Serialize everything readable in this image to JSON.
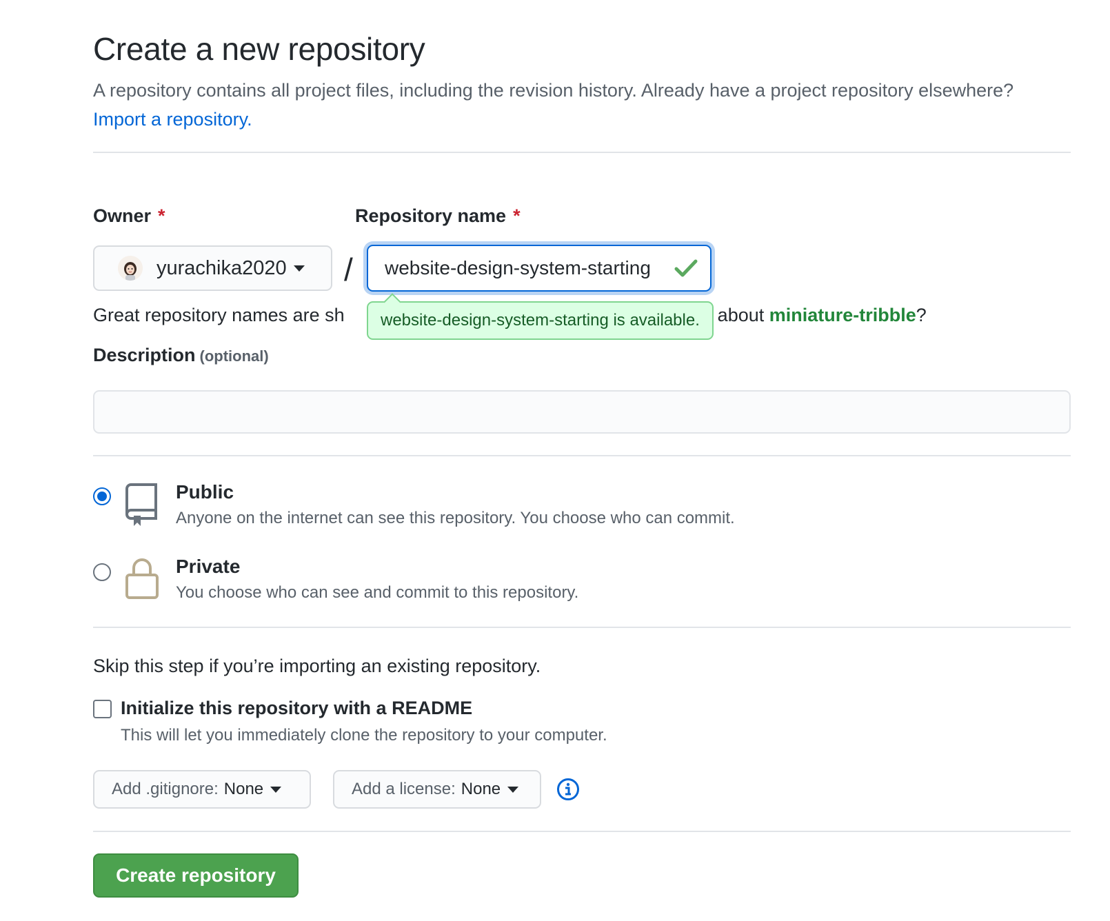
{
  "header": {
    "title": "Create a new repository",
    "subtitle": "A repository contains all project files, including the revision history. Already have a project repository elsewhere?",
    "import_link": "Import a repository."
  },
  "owner": {
    "label": "Owner",
    "required_mark": "*",
    "value": "yurachika2020"
  },
  "slash": "/",
  "repo_name": {
    "label": "Repository name",
    "required_mark": "*",
    "value": "website-design-system-starting"
  },
  "hint": {
    "prefix": "Great repository names are sh",
    "suffix": "about",
    "suggestion": "miniature-tribble",
    "end": "?"
  },
  "availability": "website-design-system-starting is available.",
  "description": {
    "label": "Description",
    "optional": "(optional)",
    "value": ""
  },
  "visibility": {
    "public": {
      "title": "Public",
      "desc": "Anyone on the internet can see this repository. You choose who can commit.",
      "selected": true
    },
    "private": {
      "title": "Private",
      "desc": "You choose who can see and commit to this repository.",
      "selected": false
    }
  },
  "init": {
    "skip_text": "Skip this step if you’re importing an existing repository.",
    "readme_label": "Initialize this repository with a README",
    "readme_desc": "This will let you immediately clone the repository to your computer."
  },
  "gitignore": {
    "label": "Add .gitignore:",
    "value": "None"
  },
  "license": {
    "label": "Add a license:",
    "value": "None"
  },
  "create_button": "Create repository",
  "colors": {
    "accent_blue": "#0366d6",
    "success_green": "#28a745",
    "create_green": "#4ca24f",
    "required_red": "#cb2431"
  }
}
